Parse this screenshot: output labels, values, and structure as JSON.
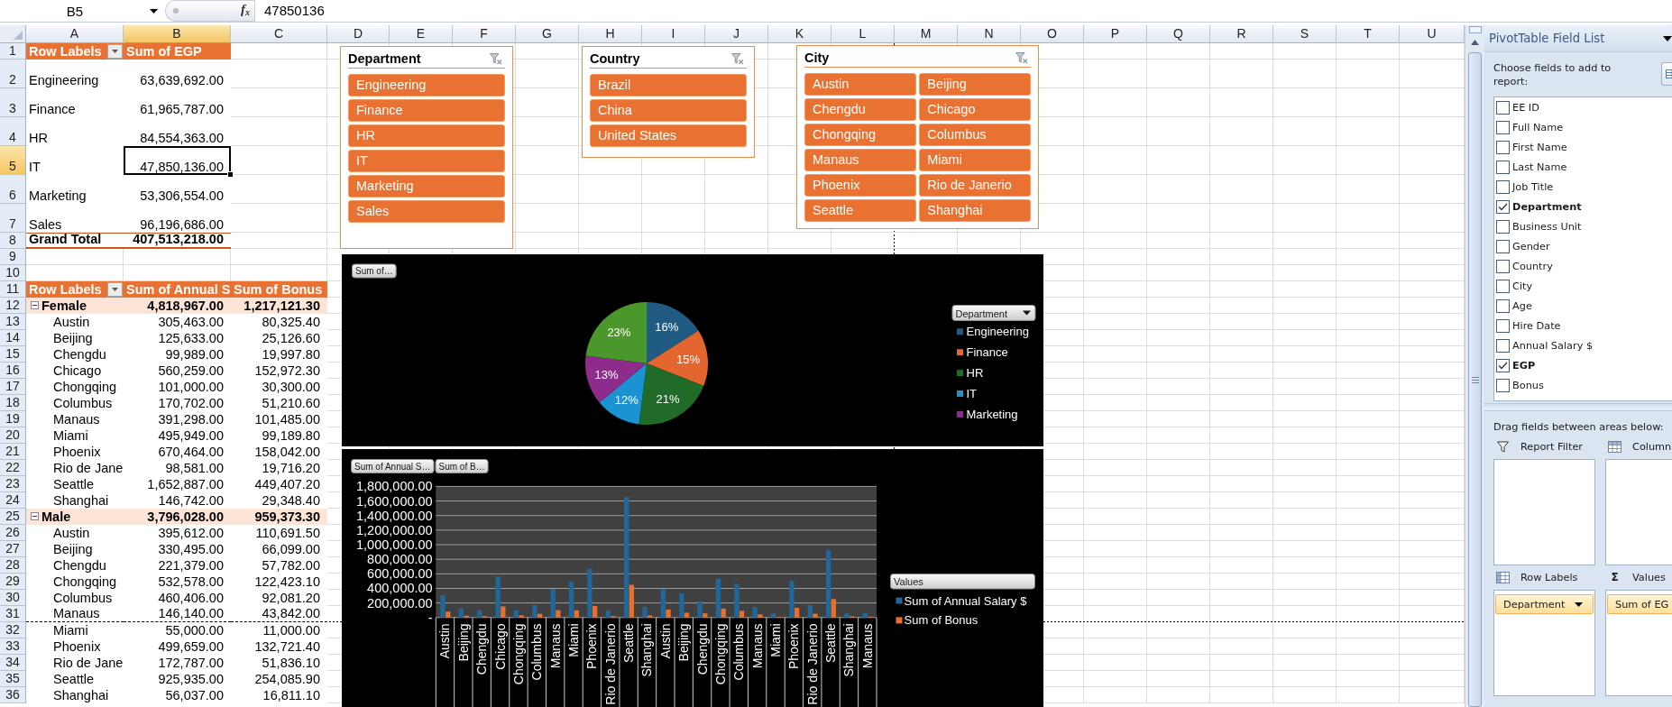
{
  "formula_bar": {
    "name_box": "B5",
    "function_button": "f$_{x}$",
    "value": "47850136"
  },
  "sheet": {
    "columns": [
      {
        "label": "A",
        "selected": false,
        "page_break": false
      },
      {
        "label": "B",
        "selected": true,
        "page_break": false
      },
      {
        "label": "C",
        "selected": false,
        "page_break": false
      },
      {
        "label": "D",
        "selected": false,
        "page_break": false
      },
      {
        "label": "E",
        "selected": false,
        "page_break": false
      },
      {
        "label": "F",
        "selected": false,
        "page_break": false
      },
      {
        "label": "G",
        "selected": false,
        "page_break": false
      },
      {
        "label": "H",
        "selected": false,
        "page_break": false
      },
      {
        "label": "I",
        "selected": false,
        "page_break": false
      },
      {
        "label": "J",
        "selected": false,
        "page_break": false
      },
      {
        "label": "K",
        "selected": false,
        "page_break": false
      },
      {
        "label": "L",
        "selected": false,
        "page_break": true
      },
      {
        "label": "M",
        "selected": false,
        "page_break": false
      },
      {
        "label": "N",
        "selected": false,
        "page_break": false
      },
      {
        "label": "O",
        "selected": false,
        "page_break": false
      },
      {
        "label": "P",
        "selected": false,
        "page_break": false
      },
      {
        "label": "Q",
        "selected": false,
        "page_break": false
      },
      {
        "label": "R",
        "selected": false,
        "page_break": false
      },
      {
        "label": "S",
        "selected": false,
        "page_break": false
      },
      {
        "label": "T",
        "selected": false,
        "page_break": false
      },
      {
        "label": "U",
        "selected": false,
        "page_break": false
      }
    ],
    "rows": [
      {
        "label": "1",
        "selected": false,
        "page_break": false
      },
      {
        "label": "2",
        "selected": false,
        "page_break": false
      },
      {
        "label": "3",
        "selected": false,
        "page_break": false
      },
      {
        "label": "4",
        "selected": false,
        "page_break": false
      },
      {
        "label": "5",
        "selected": true,
        "page_break": false
      },
      {
        "label": "6",
        "selected": false,
        "page_break": false
      },
      {
        "label": "7",
        "selected": false,
        "page_break": false
      },
      {
        "label": "8",
        "selected": false,
        "page_break": false
      },
      {
        "label": "9",
        "selected": false,
        "page_break": false
      },
      {
        "label": "10",
        "selected": false,
        "page_break": false
      },
      {
        "label": "11",
        "selected": false,
        "page_break": false
      },
      {
        "label": "12",
        "selected": false,
        "page_break": false
      },
      {
        "label": "13",
        "selected": false,
        "page_break": false
      },
      {
        "label": "14",
        "selected": false,
        "page_break": false
      },
      {
        "label": "15",
        "selected": false,
        "page_break": false
      },
      {
        "label": "16",
        "selected": false,
        "page_break": false
      },
      {
        "label": "17",
        "selected": false,
        "page_break": false
      },
      {
        "label": "18",
        "selected": false,
        "page_break": false
      },
      {
        "label": "19",
        "selected": false,
        "page_break": false
      },
      {
        "label": "20",
        "selected": false,
        "page_break": false
      },
      {
        "label": "21",
        "selected": false,
        "page_break": false
      },
      {
        "label": "22",
        "selected": false,
        "page_break": false
      },
      {
        "label": "23",
        "selected": false,
        "page_break": false
      },
      {
        "label": "24",
        "selected": false,
        "page_break": false
      },
      {
        "label": "25",
        "selected": false,
        "page_break": false
      },
      {
        "label": "26",
        "selected": false,
        "page_break": false
      },
      {
        "label": "27",
        "selected": false,
        "page_break": false
      },
      {
        "label": "28",
        "selected": false,
        "page_break": false
      },
      {
        "label": "29",
        "selected": false,
        "page_break": false
      },
      {
        "label": "30",
        "selected": false,
        "page_break": false
      },
      {
        "label": "31",
        "selected": false,
        "page_break": true
      },
      {
        "label": "32",
        "selected": false,
        "page_break": false
      },
      {
        "label": "33",
        "selected": false,
        "page_break": false
      },
      {
        "label": "34",
        "selected": false,
        "page_break": false
      },
      {
        "label": "35",
        "selected": false,
        "page_break": false
      },
      {
        "label": "36",
        "selected": false,
        "page_break": false
      }
    ]
  },
  "pivot_egp": {
    "headers": [
      "Row Labels",
      "Sum of EGP"
    ],
    "rows": [
      {
        "label": "Engineering",
        "value": "63,639,692.00",
        "selected": false
      },
      {
        "label": "Finance",
        "value": "61,965,787.00",
        "selected": false
      },
      {
        "label": "HR",
        "value": "84,554,363.00",
        "selected": false
      },
      {
        "label": "IT",
        "value": "47,850,136.00",
        "selected": true
      },
      {
        "label": "Marketing",
        "value": "53,306,554.00",
        "selected": false
      },
      {
        "label": "Sales",
        "value": "96,196,686.00",
        "selected": false
      }
    ],
    "total": {
      "label": "Grand Total",
      "value": "407,513,218.00"
    }
  },
  "pivot_gender": {
    "headers": [
      "Row Labels",
      "Sum of Annual S",
      "Sum of Bonus"
    ],
    "groups": [
      {
        "label": "Female",
        "expanded": true,
        "salary": "4,818,967.00",
        "bonus": "1,217,121.30",
        "children": [
          {
            "label": "Austin",
            "salary": "305,463.00",
            "bonus": "80,325.40"
          },
          {
            "label": "Beijing",
            "salary": "125,633.00",
            "bonus": "25,126.60"
          },
          {
            "label": "Chengdu",
            "salary": "99,989.00",
            "bonus": "19,997.80"
          },
          {
            "label": "Chicago",
            "salary": "560,259.00",
            "bonus": "152,972.30"
          },
          {
            "label": "Chongqing",
            "salary": "101,000.00",
            "bonus": "30,300.00"
          },
          {
            "label": "Columbus",
            "salary": "170,702.00",
            "bonus": "51,210.60"
          },
          {
            "label": "Manaus",
            "salary": "391,298.00",
            "bonus": "101,485.00"
          },
          {
            "label": "Miami",
            "salary": "495,949.00",
            "bonus": "99,189.80"
          },
          {
            "label": "Phoenix",
            "salary": "670,464.00",
            "bonus": "158,042.00"
          },
          {
            "label": "Rio de Jane",
            "salary": "98,581.00",
            "bonus": "19,716.20"
          },
          {
            "label": "Seattle",
            "salary": "1,652,887.00",
            "bonus": "449,407.20"
          },
          {
            "label": "Shanghai",
            "salary": "146,742.00",
            "bonus": "29,348.40"
          }
        ]
      },
      {
        "label": "Male",
        "expanded": true,
        "salary": "3,796,028.00",
        "bonus": "959,373.30",
        "children": [
          {
            "label": "Austin",
            "salary": "395,612.00",
            "bonus": "110,691.50"
          },
          {
            "label": "Beijing",
            "salary": "330,495.00",
            "bonus": "66,099.00"
          },
          {
            "label": "Chengdu",
            "salary": "221,379.00",
            "bonus": "57,782.00"
          },
          {
            "label": "Chongqing",
            "salary": "532,578.00",
            "bonus": "122,423.10"
          },
          {
            "label": "Columbus",
            "salary": "460,406.00",
            "bonus": "92,081.20"
          },
          {
            "label": "Manaus",
            "salary": "146,140.00",
            "bonus": "43,842.00"
          },
          {
            "label": "Miami",
            "salary": "55,000.00",
            "bonus": "11,000.00"
          },
          {
            "label": "Phoenix",
            "salary": "499,659.00",
            "bonus": "132,721.40"
          },
          {
            "label": "Rio de Jane",
            "salary": "172,787.00",
            "bonus": "51,836.10"
          },
          {
            "label": "Seattle",
            "salary": "925,935.00",
            "bonus": "254,085.90"
          },
          {
            "label": "Shanghai",
            "salary": "56,037.00",
            "bonus": "16,811.10"
          }
        ]
      }
    ]
  },
  "slicers": [
    {
      "title": "Department",
      "items": [
        {
          "label": "Engineering",
          "selected": true
        },
        {
          "label": "Finance",
          "selected": true
        },
        {
          "label": "HR",
          "selected": true
        },
        {
          "label": "IT",
          "selected": true
        },
        {
          "label": "Marketing",
          "selected": true
        },
        {
          "label": "Sales",
          "selected": true
        }
      ]
    },
    {
      "title": "Country",
      "items": [
        {
          "label": "Brazil",
          "selected": true
        },
        {
          "label": "China",
          "selected": true
        },
        {
          "label": "United States",
          "selected": true
        }
      ]
    },
    {
      "title": "City",
      "items": [
        {
          "label": "Austin",
          "selected": true
        },
        {
          "label": "Beijing",
          "selected": true
        },
        {
          "label": "Chengdu",
          "selected": true
        },
        {
          "label": "Chicago",
          "selected": true
        },
        {
          "label": "Chongqing",
          "selected": true
        },
        {
          "label": "Columbus",
          "selected": true
        },
        {
          "label": "Manaus",
          "selected": true
        },
        {
          "label": "Miami",
          "selected": true
        },
        {
          "label": "Phoenix",
          "selected": true
        },
        {
          "label": "Rio de Janerio",
          "selected": true
        },
        {
          "label": "Seattle",
          "selected": true
        },
        {
          "label": "Shanghai",
          "selected": true
        }
      ]
    }
  ],
  "pie_chart": {
    "field_button": "Sum of…",
    "legend_button": "Department",
    "chart_data": {
      "type": "pie",
      "categories": [
        "Engineering",
        "Finance",
        "HR",
        "IT",
        "Marketing",
        null
      ],
      "values": [
        16,
        15,
        21,
        12,
        13,
        23
      ],
      "value_labels": [
        "16%",
        "15%",
        "21%",
        "12%",
        "13%",
        "23%"
      ],
      "colors": [
        "#1f5b82",
        "#e2662e",
        "#1f6b27",
        "#1b92d2",
        "#8e2c8c",
        "#4a982c"
      ],
      "legend": "right"
    }
  },
  "bar_chart": {
    "field_buttons": [
      "Sum of Annual S…",
      "Sum of B…"
    ],
    "legend_button": "Values",
    "chart_data": {
      "type": "bar",
      "categories": [
        "Austin",
        "Beijing",
        "Chengdu",
        "Chicago",
        "Chongqing",
        "Columbus",
        "Manaus",
        "Miami",
        "Phoenix",
        "Rio de Janerio",
        "Seattle",
        "Shanghai",
        "Austin",
        "Beijing",
        "Chengdu",
        "Chongqing",
        "Columbus",
        "Manaus",
        "Miami",
        "Phoenix",
        "Rio de Janerio",
        "Seattle",
        "Shanghai",
        "Manaus"
      ],
      "series": [
        {
          "name": "Sum of Annual Salary $",
          "color": "#20679a",
          "values": [
            305463,
            125633,
            99989,
            560259,
            101000,
            170702,
            391298,
            495949,
            670464,
            98581,
            1652887,
            146742,
            395612,
            330495,
            221379,
            532578,
            460406,
            146140,
            55000,
            499659,
            172787,
            925935,
            56037,
            60000
          ]
        },
        {
          "name": "Sum of Bonus",
          "color": "#ea6f2d",
          "values": [
            80325.4,
            25126.6,
            19997.8,
            152972.3,
            30300,
            51210.6,
            101485,
            99189.8,
            158042,
            19716.2,
            449407.2,
            29348.4,
            110691.5,
            66099,
            57782,
            122423.1,
            92081.2,
            43842,
            11000,
            132721.4,
            51836.1,
            254085.9,
            16811.1,
            12000
          ]
        }
      ],
      "ylim": [
        0,
        1800000
      ],
      "yticks": [
        {
          "value": 0,
          "label": "-"
        },
        {
          "value": 200000,
          "label": "200,000.00"
        },
        {
          "value": 400000,
          "label": "400,000.00"
        },
        {
          "value": 600000,
          "label": "600,000.00"
        },
        {
          "value": 800000,
          "label": "800,000.00"
        },
        {
          "value": 1000000,
          "label": "1,000,000.00"
        },
        {
          "value": 1200000,
          "label": "1,200,000.00"
        },
        {
          "value": 1400000,
          "label": "1,400,000.00"
        },
        {
          "value": 1600000,
          "label": "1,600,000.00"
        },
        {
          "value": 1800000,
          "label": "1,800,000.00"
        }
      ],
      "grid": true,
      "legend": "right"
    }
  },
  "field_list": {
    "title": "PivotTable Field List",
    "prompt": "Choose fields to add to report:",
    "fields": [
      {
        "label": "EE ID",
        "checked": false
      },
      {
        "label": "Full Name",
        "checked": false
      },
      {
        "label": "First Name",
        "checked": false
      },
      {
        "label": "Last Name",
        "checked": false
      },
      {
        "label": "Job Title",
        "checked": false
      },
      {
        "label": "Department",
        "checked": true
      },
      {
        "label": "Business Unit",
        "checked": false
      },
      {
        "label": "Gender",
        "checked": false
      },
      {
        "label": "Country",
        "checked": false
      },
      {
        "label": "City",
        "checked": false
      },
      {
        "label": "Age",
        "checked": false
      },
      {
        "label": "Hire Date",
        "checked": false
      },
      {
        "label": "Annual Salary $",
        "checked": false
      },
      {
        "label": "EGP",
        "checked": true
      },
      {
        "label": "Bonus",
        "checked": false
      }
    ],
    "areas_prompt": "Drag fields between areas below:",
    "areas": [
      {
        "kind": "filter",
        "label": "Report Filter"
      },
      {
        "kind": "columns",
        "label": "Column"
      },
      {
        "kind": "rows",
        "label": "Row Labels",
        "fields": [
          "Department"
        ]
      },
      {
        "kind": "values",
        "label": "Values",
        "symbol": "Σ",
        "fields": [
          "Sum of EG"
        ]
      }
    ]
  }
}
